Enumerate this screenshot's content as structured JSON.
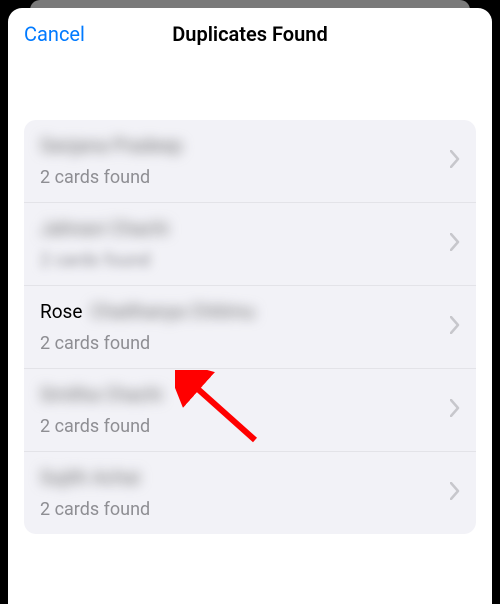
{
  "header": {
    "cancel_label": "Cancel",
    "title": "Duplicates Found"
  },
  "list": [
    {
      "name": "Sanjana Pradeep",
      "subtitle": "2 cards found",
      "blurred": true
    },
    {
      "name": "Jahnavi Chachi",
      "subtitle": "2 cards found",
      "blurred": true,
      "subtitle_blurred": true
    },
    {
      "name_visible": "Rose",
      "name_rest": "Chaithanya Chitimu",
      "subtitle": "2 cards found",
      "partial": true
    },
    {
      "name": "Smitha Chachi",
      "subtitle": "2 cards found",
      "blurred": true
    },
    {
      "name": "Sujith Achai",
      "subtitle": "2 cards found",
      "blurred": true
    }
  ],
  "arrow_color": "#ff0000"
}
